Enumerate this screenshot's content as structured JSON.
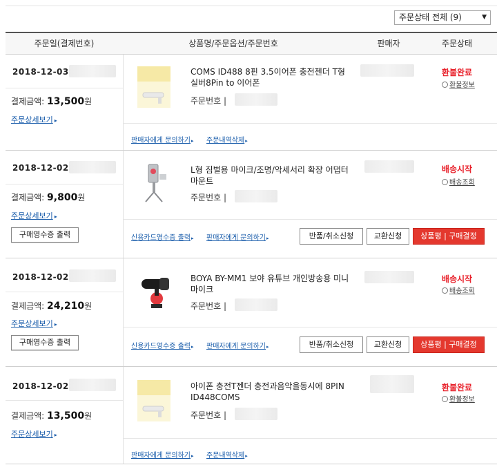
{
  "filter": {
    "label": "주문상태 전체 (9)"
  },
  "header": {
    "col_date": "주문일(결제번호)",
    "col_product": "상품명/주문옵션/주문번호",
    "col_seller": "판매자",
    "col_status": "주문상태"
  },
  "orders": [
    {
      "date": "2018-12-03",
      "amount_label": "결제금액:",
      "amount_value": "13,500",
      "amount_unit": "원",
      "detail_link": "주문상세보기",
      "product_name": "COMS ID488 8핀 3.5이어폰 충전젠더 T형 실버8Pin to 이어폰",
      "order_no_label": "주문번호 |",
      "status": "환불완료",
      "status_link": "환불정보",
      "links": [
        "판매자에게 문의하기",
        "주문내역삭제"
      ]
    },
    {
      "date": "2018-12-02",
      "amount_label": "결제금액:",
      "amount_value": "9,800",
      "amount_unit": "원",
      "detail_link": "주문상세보기",
      "receipt_button": "구매영수증 출력",
      "product_name": "L형 짐벌용 마이크/조명/악세서리 확장 어댑터 마운트",
      "order_no_label": "주문번호 |",
      "status": "배송시작",
      "status_link": "배송조회",
      "links": [
        "신용카드영수증 출력",
        "판매자에게 문의하기"
      ],
      "buttons": [
        "반품/취소신청",
        "교환신청",
        "상품평 | 구매결정"
      ]
    },
    {
      "date": "2018-12-02",
      "amount_label": "결제금액:",
      "amount_value": "24,210",
      "amount_unit": "원",
      "detail_link": "주문상세보기",
      "receipt_button": "구매영수증 출력",
      "product_name": "BOYA BY-MM1 보야 유튜브 개인방송용 미니마이크",
      "order_no_label": "주문번호 |",
      "status": "배송시작",
      "status_link": "배송조회",
      "links": [
        "신용카드영수증 출력",
        "판매자에게 문의하기"
      ],
      "buttons": [
        "반품/취소신청",
        "교환신청",
        "상품평 | 구매결정"
      ]
    },
    {
      "date": "2018-12-02",
      "amount_label": "결제금액:",
      "amount_value": "13,500",
      "amount_unit": "원",
      "detail_link": "주문상세보기",
      "product_name": "아이폰 충전T젠더 충전과음악을동시에 8PIN ID448COMS",
      "order_no_label": "주문번호 |",
      "status": "환불완료",
      "status_link": "환불정보",
      "links": [
        "판매자에게 문의하기",
        "주문내역삭제"
      ]
    }
  ],
  "colors": {
    "status_red": "#e8202a",
    "link_blue": "#1a5dab",
    "button_red": "#e4382e"
  }
}
